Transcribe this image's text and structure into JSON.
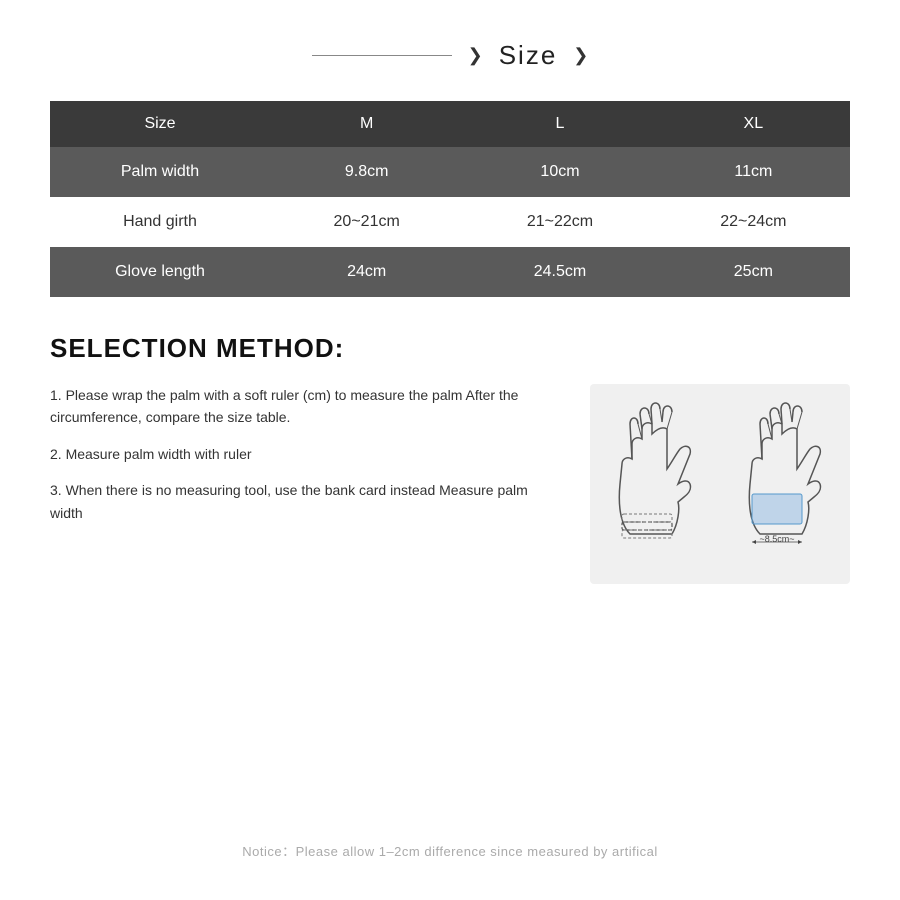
{
  "header": {
    "title": "Size",
    "chevron_left": "❯",
    "chevron_right": "❯"
  },
  "table": {
    "headers": [
      "Size",
      "M",
      "L",
      "XL"
    ],
    "rows": [
      {
        "label": "Palm width",
        "m": "9.8cm",
        "l": "10cm",
        "xl": "11cm"
      },
      {
        "label": "Hand girth",
        "m": "20~21cm",
        "l": "21~22cm",
        "xl": "22~24cm"
      },
      {
        "label": "Glove length",
        "m": "24cm",
        "l": "24.5cm",
        "xl": "25cm"
      }
    ]
  },
  "selection": {
    "title": "SELECTION METHOD:",
    "steps": [
      "1. Please wrap the palm with a soft ruler (cm) to measure the palm After the circumference, compare the size table.",
      "2. Measure palm width with ruler",
      "3. When there is no measuring tool, use the bank card instead Measure palm width"
    ]
  },
  "notice": "Notice：Please allow 1–2cm difference since measured by artifical",
  "glove": {
    "measurement_label": "~8.5cm~"
  }
}
